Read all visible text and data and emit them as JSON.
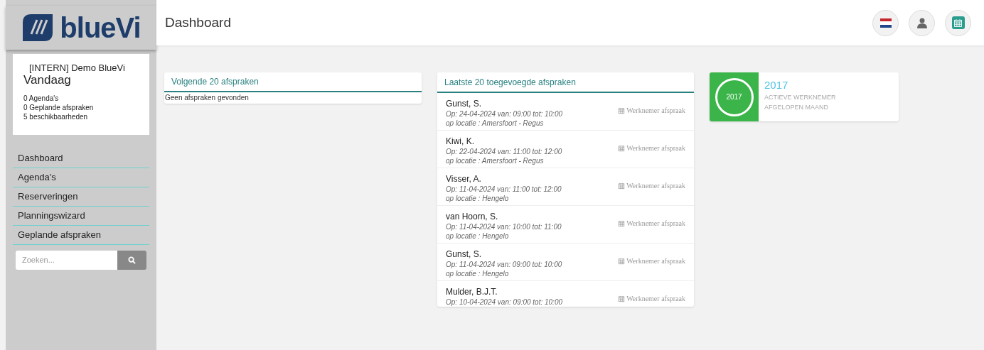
{
  "logo": {
    "text": "blueVi"
  },
  "header": {
    "title": "Dashboard"
  },
  "summary": {
    "organisation": "[INTERN] Demo BlueVi",
    "heading": "Vandaag",
    "stats": [
      "0 Agenda's",
      "0 Geplande afspraken",
      "5 beschikbaarheden"
    ]
  },
  "nav": [
    "Dashboard",
    "Agenda's",
    "Reserveringen",
    "Planningswizard",
    "Geplande afspraken"
  ],
  "search": {
    "placeholder": "Zoeken..."
  },
  "upcoming": {
    "title": "Volgende 20 afspraken",
    "empty": "Geen afspraken gevonden"
  },
  "recent": {
    "title": "Laatste 20 toegevoegde afspraken",
    "items": [
      {
        "name": "Gunst, S.",
        "time": "Op: 24-04-2024 van: 09:00 tot: 10:00",
        "location": "op locatie : Amersfoort - Regus",
        "type": "Werknemer afspraak"
      },
      {
        "name": "Kiwi, K.",
        "time": "Op: 22-04-2024 van: 11:00 tot: 12:00",
        "location": "op locatie : Amersfoort - Regus",
        "type": "Werknemer afspraak"
      },
      {
        "name": "Visser, A.",
        "time": "Op: 11-04-2024 van: 11:00 tot: 12:00",
        "location": "op locatie : Hengelo",
        "type": "Werknemer afspraak"
      },
      {
        "name": "van Hoorn, S.",
        "time": "Op: 11-04-2024 van: 10:00 tot: 11:00",
        "location": "op locatie : Hengelo",
        "type": "Werknemer afspraak"
      },
      {
        "name": "Gunst, S.",
        "time": "Op: 11-04-2024 van: 09:00 tot: 10:00",
        "location": "op locatie : Hengelo",
        "type": "Werknemer afspraak"
      },
      {
        "name": "Mulder, B.J.T.",
        "time": "Op: 10-04-2024 van: 09:00 tot: 10:00",
        "type": "Werknemer afspraak"
      }
    ]
  },
  "stat_card": {
    "badge": "2017",
    "value": "2017",
    "label_1": "ACTIEVE WERKNEMER",
    "label_2": "AFGELOPEN MAAND"
  }
}
